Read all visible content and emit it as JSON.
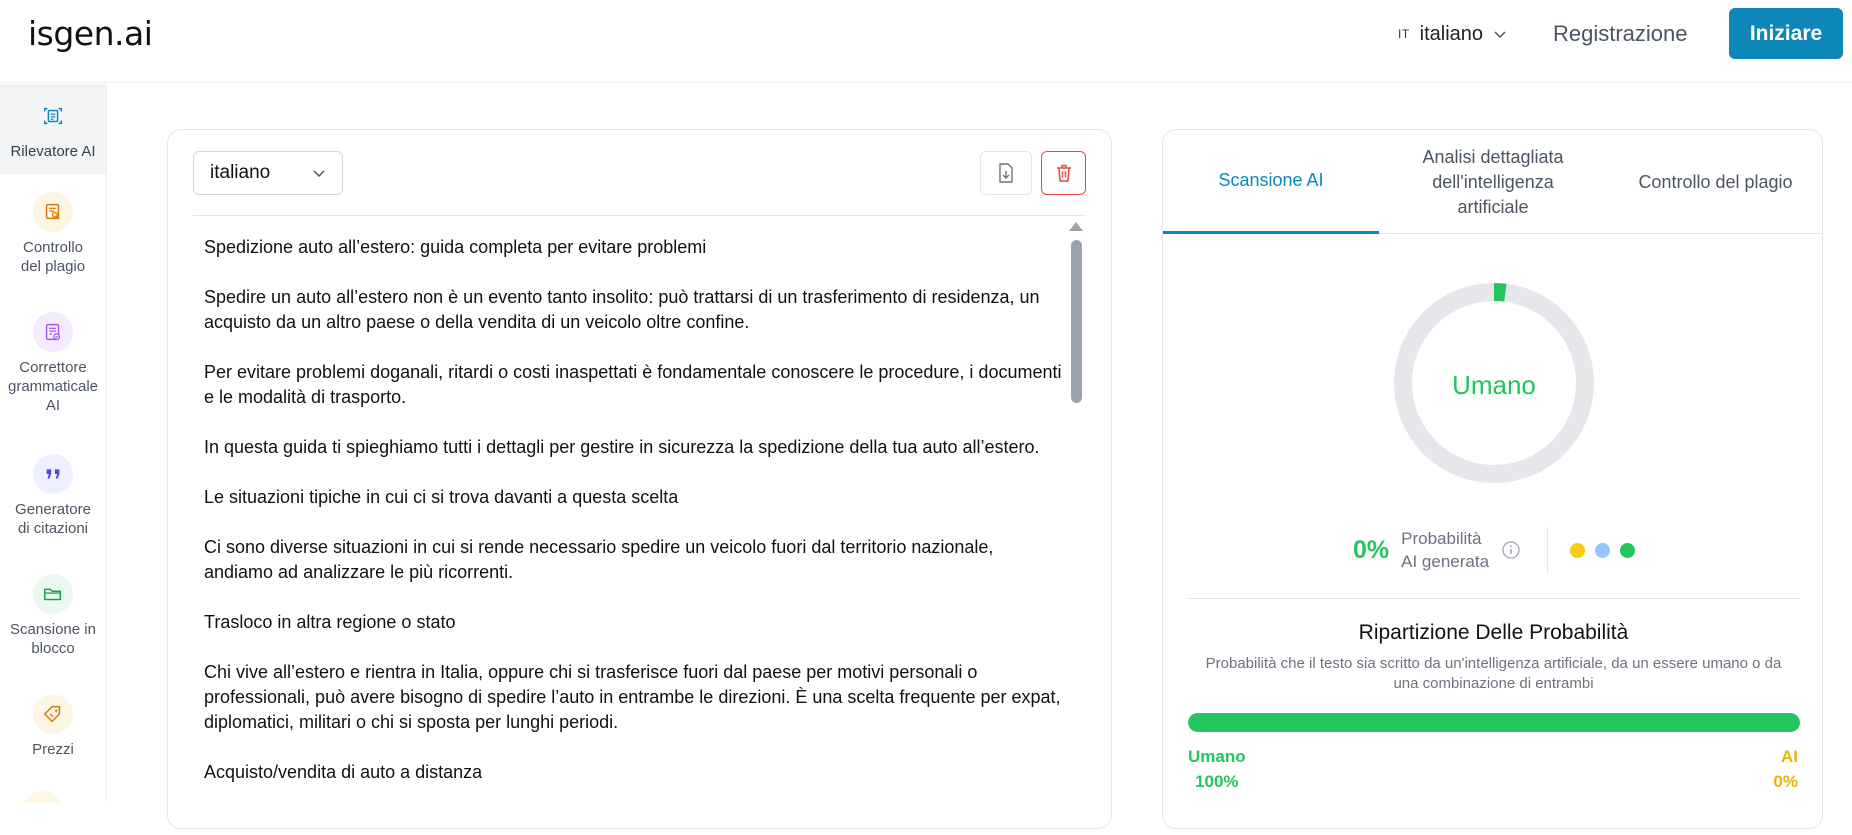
{
  "header": {
    "logo": "isgen.ai",
    "language_code": "IT",
    "language_name": "italiano",
    "register_label": "Registrazione",
    "start_label": "Iniziare"
  },
  "sidebar": {
    "items": [
      {
        "label": "Rilevatore AI",
        "icon": "ai-detector-icon",
        "active": true
      },
      {
        "label": "Controllo del plagio",
        "icon": "plagiarism-check-icon"
      },
      {
        "label": "Correttore grammaticale AI",
        "icon": "grammar-checker-icon"
      },
      {
        "label": "Generatore di citazioni",
        "icon": "quote-icon"
      },
      {
        "label": "Scansione in blocco",
        "icon": "folder-icon"
      },
      {
        "label": "Prezzi",
        "icon": "price-tag-icon"
      }
    ]
  },
  "editor": {
    "language": "italiano",
    "paragraphs": [
      "Spedizione auto all’estero: guida completa per evitare problemi",
      "Spedire un auto all’estero non è un evento tanto insolito: può trattarsi di un trasferimento di residenza, un acquisto da un altro paese o della vendita di un veicolo oltre confine.",
      "Per evitare problemi doganali, ritardi o costi inaspettati è fondamentale conoscere le procedure, i documenti e le modalità di trasporto.",
      "In questa guida ti spieghiamo tutti i dettagli per gestire in sicurezza la spedizione della tua auto all’estero.",
      "Le situazioni tipiche in cui ci si trova davanti a questa scelta",
      "Ci sono diverse situazioni in cui si rende necessario spedire un veicolo fuori dal territorio nazionale, andiamo ad analizzare le più ricorrenti.",
      "Trasloco in altra regione o stato",
      "Chi vive all’estero e rientra in Italia, oppure chi si trasferisce fuori dal paese per motivi personali o professionali, può avere bisogno di spedire l’auto in entrambe le direzioni. È una scelta frequente per expat, diplomatici, militari o chi si sposta per lunghi periodi.",
      "Acquisto/vendita di auto a distanza"
    ]
  },
  "results": {
    "tabs": [
      {
        "label": "Scansione AI",
        "active": true
      },
      {
        "label": "Analisi dettagliata dell'intelligenza artificiale"
      },
      {
        "label": "Controllo del plagio"
      }
    ],
    "gauge_label": "Umano",
    "ai_fraction": 0.02,
    "ai_probability": "0%",
    "probability_text_1": "Probabilità",
    "probability_text_2": "AI generata",
    "dot_colors": [
      "#facc15",
      "#93c5fd",
      "#22c55e"
    ],
    "breakdown_title": "Ripartizione Delle Probabilità",
    "breakdown_subtitle": "Probabilità che il testo sia scritto da un'intelligenza artificiale, da un essere umano o da una combinazione di entrambi",
    "human_fraction": 1.0,
    "human_label": "Umano",
    "human_pct": "100%",
    "ai_label": "AI",
    "ai_pct": "0%"
  },
  "colors": {
    "accent": "#0d87b8",
    "human_green": "#22c55e",
    "ai_yellow": "#eab308",
    "delete_red": "#ef4444"
  }
}
